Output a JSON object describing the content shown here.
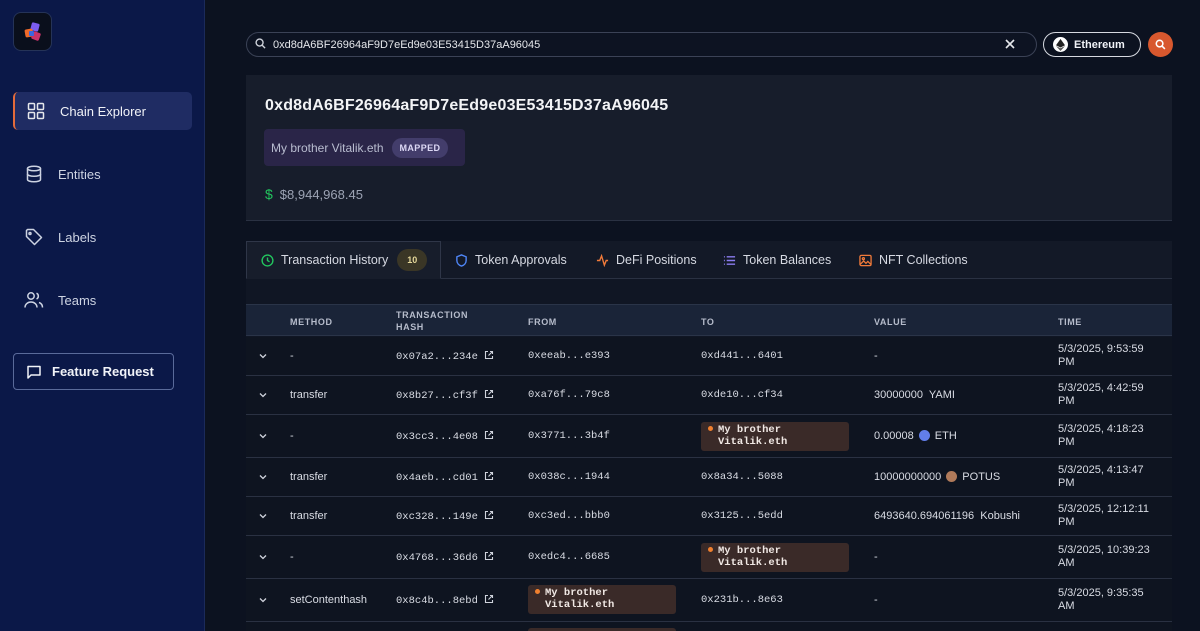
{
  "sidebar": {
    "items": [
      {
        "label": "Chain Explorer",
        "icon": "grid-icon"
      },
      {
        "label": "Entities",
        "icon": "database-icon"
      },
      {
        "label": "Labels",
        "icon": "tag-icon"
      },
      {
        "label": "Teams",
        "icon": "users-icon"
      }
    ],
    "feature_request": "Feature Request"
  },
  "search": {
    "value": "0xd8dA6BF26964aF9D7eEd9e03E53415D37aA96045",
    "network": "Ethereum"
  },
  "address": {
    "title": "0xd8dA6BF26964aF9D7eEd9e03E53415D37aA96045",
    "label": "My brother Vitalik.eth",
    "badge": "MAPPED",
    "balance": "$8,944,968.45",
    "balance_symbol": "$"
  },
  "tabs": [
    {
      "label": "Transaction History",
      "count": "10",
      "icon": "clock-icon"
    },
    {
      "label": "Token Approvals",
      "icon": "shield-icon"
    },
    {
      "label": "DeFi Positions",
      "icon": "activity-icon"
    },
    {
      "label": "Token Balances",
      "icon": "list-icon"
    },
    {
      "label": "NFT Collections",
      "icon": "image-icon"
    }
  ],
  "table": {
    "headers": [
      "METHOD",
      "TRANSACTION HASH",
      "FROM",
      "TO",
      "VALUE",
      "TIME"
    ],
    "rows": [
      {
        "method": "-",
        "hash": "0x07a2...234e",
        "from": "0xeeab...e393",
        "to": "0xd441...6401",
        "value": "-",
        "time": "5/3/2025, 9:53:59 PM"
      },
      {
        "method": "transfer",
        "hash": "0x8b27...cf3f",
        "from": "0xa76f...79c8",
        "to": "0xde10...cf34",
        "value_amount": "30000000",
        "value_token": "YAMI",
        "time": "5/3/2025, 4:42:59 PM"
      },
      {
        "method": "-",
        "hash": "0x3cc3...4e08",
        "from": "0x3771...3b4f",
        "to_entity": "My brother Vitalik.eth",
        "value_amount": "0.00008",
        "value_token": "ETH",
        "time": "5/3/2025, 4:18:23 PM"
      },
      {
        "method": "transfer",
        "hash": "0x4aeb...cd01",
        "from": "0x038c...1944",
        "to": "0x8a34...5088",
        "value_amount": "10000000000",
        "value_token": "POTUS",
        "time": "5/3/2025, 4:13:47 PM"
      },
      {
        "method": "transfer",
        "hash": "0xc328...149e",
        "from": "0xc3ed...bbb0",
        "to": "0x3125...5edd",
        "value_amount": "6493640.694061196",
        "value_token": "Kobushi",
        "time": "5/3/2025, 12:12:11 PM"
      },
      {
        "method": "-",
        "hash": "0x4768...36d6",
        "from": "0xedc4...6685",
        "to_entity": "My brother Vitalik.eth",
        "value": "-",
        "time": "5/3/2025, 10:39:23 AM"
      },
      {
        "method": "setContenthash",
        "hash": "0x8c4b...8ebd",
        "from_entity": "My brother Vitalik.eth",
        "to": "0x231b...8e63",
        "value": "-",
        "time": "5/3/2025, 9:35:35 AM"
      }
    ]
  },
  "colors": {
    "sidebar_bg": "#0b1848",
    "accent": "#d8582e",
    "positive": "#22c55e",
    "entity_dot": "#f0802f"
  }
}
